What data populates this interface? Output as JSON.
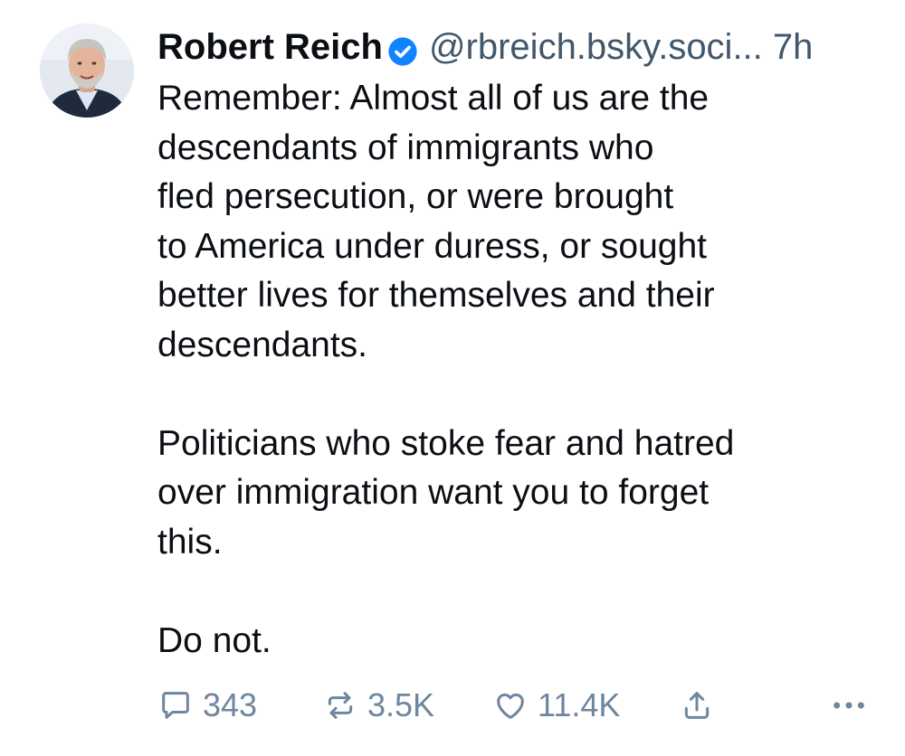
{
  "post": {
    "author": {
      "display_name": "Robert Reich",
      "handle": "@rbreich.bsky.soci...",
      "verified": true
    },
    "timestamp": "7h",
    "paragraphs": [
      "Remember: Almost all of us are the\ndescendants of immigrants who\nfled persecution, or were brought\nto America under duress, or sought\nbetter lives for themselves and their\ndescendants.",
      "Politicians who stoke fear and hatred\nover immigration want you to forget\nthis.",
      "Do not."
    ],
    "actions": {
      "replies": "343",
      "reposts": "3.5K",
      "likes": "11.4K"
    }
  },
  "icons": {
    "verified": "verified-check-icon",
    "reply": "speech-bubble-icon",
    "repost": "repost-arrows-icon",
    "like": "heart-outline-icon",
    "share": "share-upload-icon",
    "more": "ellipsis-icon"
  },
  "colors": {
    "text": "#0b0f14",
    "secondary_text": "#42576c",
    "action_gray": "#6f869f",
    "verified_blue": "#1083fe",
    "background": "#ffffff"
  }
}
